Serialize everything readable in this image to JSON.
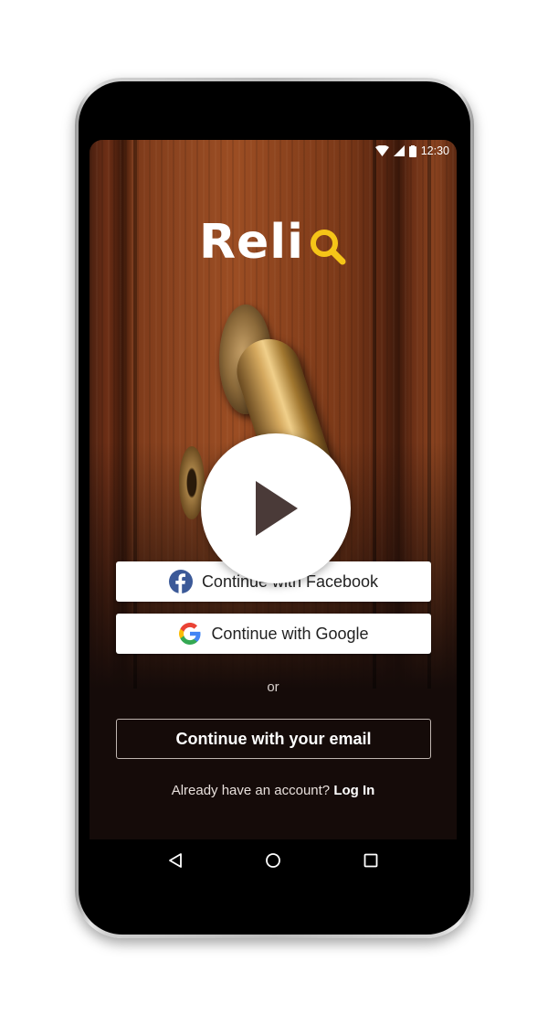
{
  "status_bar": {
    "time": "12:30"
  },
  "brand": {
    "name": "Reli",
    "accent_color": "#f5c518"
  },
  "buttons": {
    "facebook": "Continue with Facebook",
    "google": "Continue with Google",
    "email": "Continue with your email"
  },
  "divider": "or",
  "footer": {
    "prompt": "Already have an account?",
    "login": "Log In"
  },
  "nav": {
    "back": "back-triangle",
    "home": "home-circle",
    "recents": "recents-square"
  },
  "colors": {
    "facebook_blue": "#3b5998",
    "screen_bg": "#150b09"
  }
}
